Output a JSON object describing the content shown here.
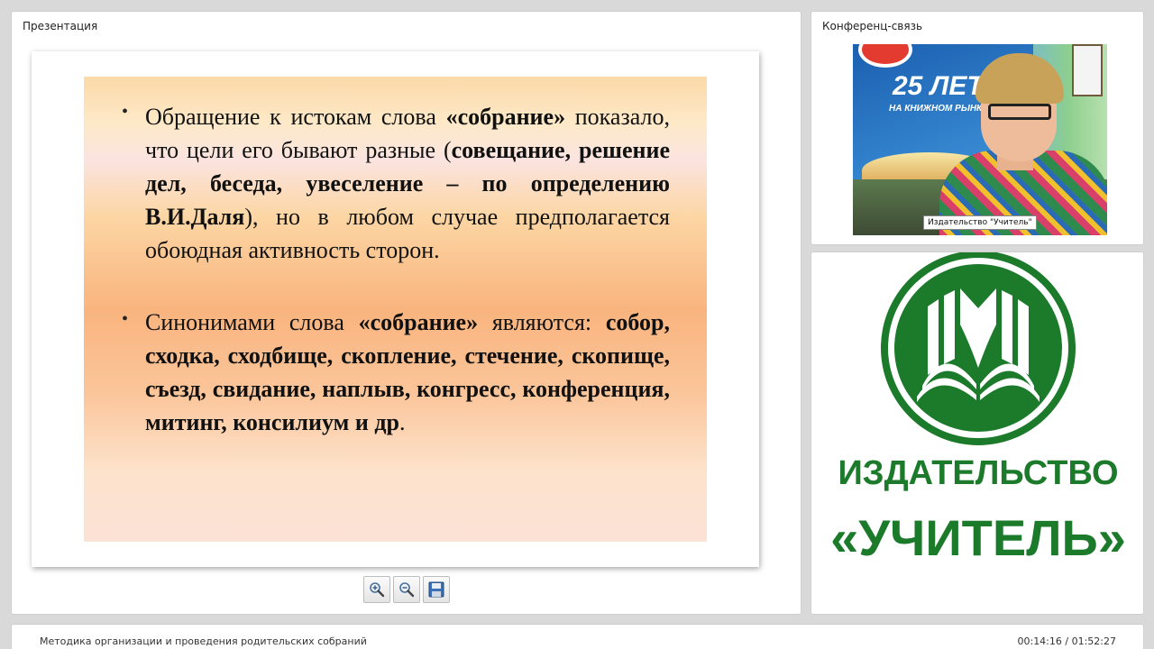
{
  "presentation": {
    "title": "Презентация",
    "slide": {
      "para1": {
        "t1": "Обращение к истокам слова ",
        "b1": "«собрание»",
        "t2": " показало, что цели его бывают разные (",
        "b2": "совещание, решение дел, беседа, увеселение – по определению В.И.Даля",
        "t3": "), но в любом случае предполагается обоюдная активность сторон."
      },
      "para2": {
        "t1": "Синонимами слова ",
        "b1": "«собрание»",
        "t2": " являются: ",
        "b2": "собор, сходка, сходбище, скопление, стечение, скопище, съезд, свидание, наплыв, конгресс, конференция, митинг, консилиум и др",
        "t3": "."
      }
    },
    "toolbar": {
      "zoom_in_icon": "zoom-in-icon",
      "zoom_out_icon": "zoom-out-icon",
      "save_icon": "save-icon"
    }
  },
  "conference": {
    "title": "Конференц-связь",
    "video_caption": "Издательство \"Учитель\"",
    "video_banner_big": "25 ЛЕТ",
    "video_banner_small": "НА КНИЖНОМ РЫНКЕ РОССИИ"
  },
  "logo": {
    "line1": "ИЗДАТЕЛЬСТВО",
    "line2": "«УЧИТЕЛЬ»",
    "color": "#1c7a2b"
  },
  "footer": {
    "title": "Методика организации и проведения родительских собраний",
    "time": "00:14:16 / 01:52:27"
  }
}
